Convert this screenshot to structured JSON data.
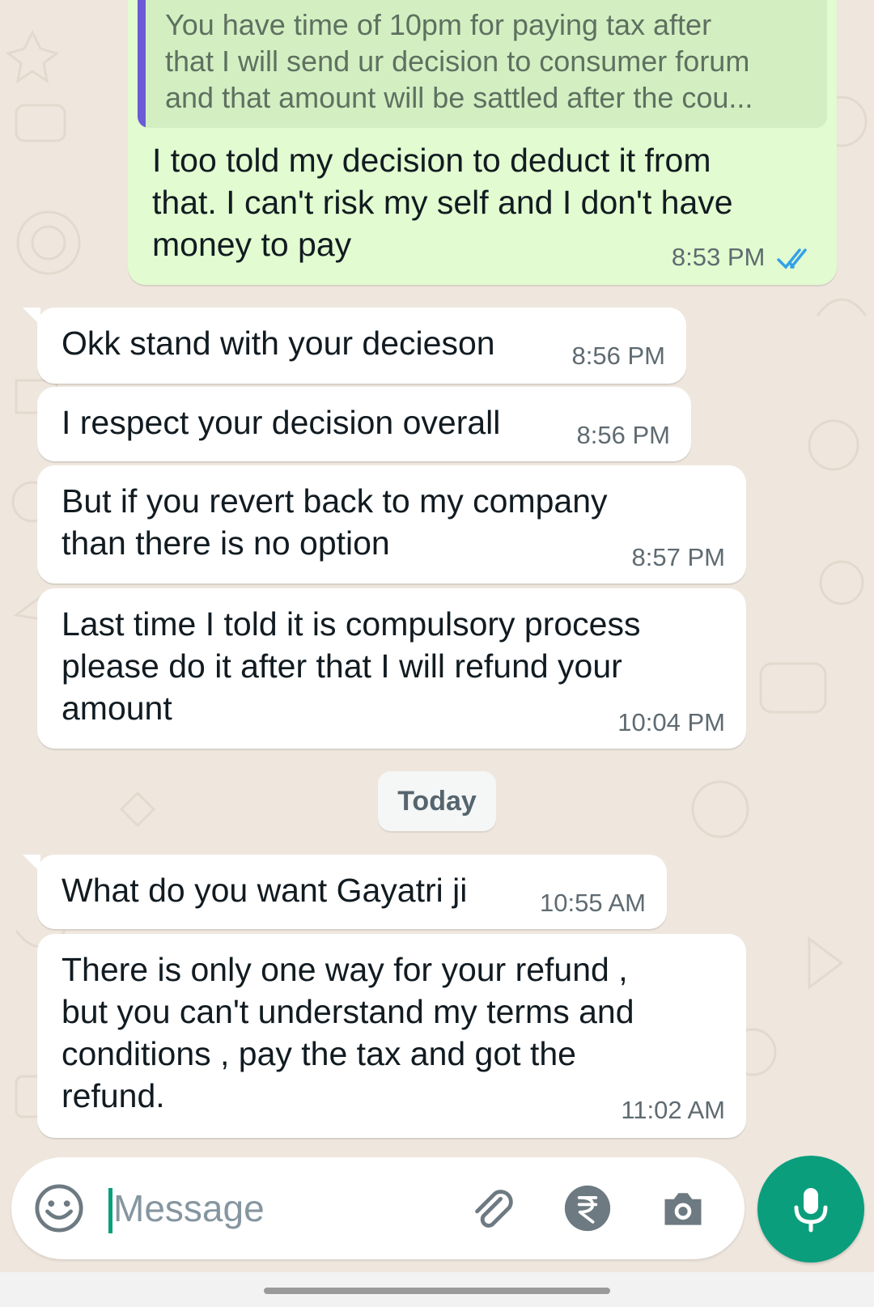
{
  "chat": {
    "quoted_message": "You have time of 10pm for paying tax after\nthat I will send ur decision to consumer forum\nand that amount will be sattled after the cou...",
    "messages": [
      {
        "direction": "out",
        "text": "I too told my decision to deduct it from\nthat. I can't risk my self and I don't have\nmoney to pay",
        "time": "8:53 PM",
        "status": "read"
      },
      {
        "direction": "in",
        "text": "Okk stand with your decieson",
        "time": "8:56 PM"
      },
      {
        "direction": "in",
        "text": "I respect your decision overall",
        "time": "8:56 PM"
      },
      {
        "direction": "in",
        "text": "But if you revert back to my company\nthan there is no option",
        "time": "8:57 PM"
      },
      {
        "direction": "in",
        "text": "Last time I told it is compulsory process\nplease do it after that I will refund your\namount",
        "time": "10:04 PM"
      },
      {
        "direction": "in",
        "text": "What do you want Gayatri ji",
        "time": "10:55 AM"
      },
      {
        "direction": "in",
        "text": "There is only one way for your refund ,\nbut you can't understand my terms and\nconditions , pay the tax and got the\nrefund.",
        "time": "11:02 AM"
      }
    ],
    "date_divider": "Today"
  },
  "composer": {
    "placeholder": "Message",
    "icons": [
      "emoji-icon",
      "attach-icon",
      "rupee-payment-icon",
      "camera-icon",
      "mic-icon"
    ]
  },
  "colors": {
    "chat_background": "#efe7de",
    "incoming_bubble": "#ffffff",
    "outgoing_bubble": "#e2fbd0",
    "quote_bar": "#6b5bd6",
    "read_ticks": "#34a1e8",
    "accent": "#0a9e7d"
  }
}
